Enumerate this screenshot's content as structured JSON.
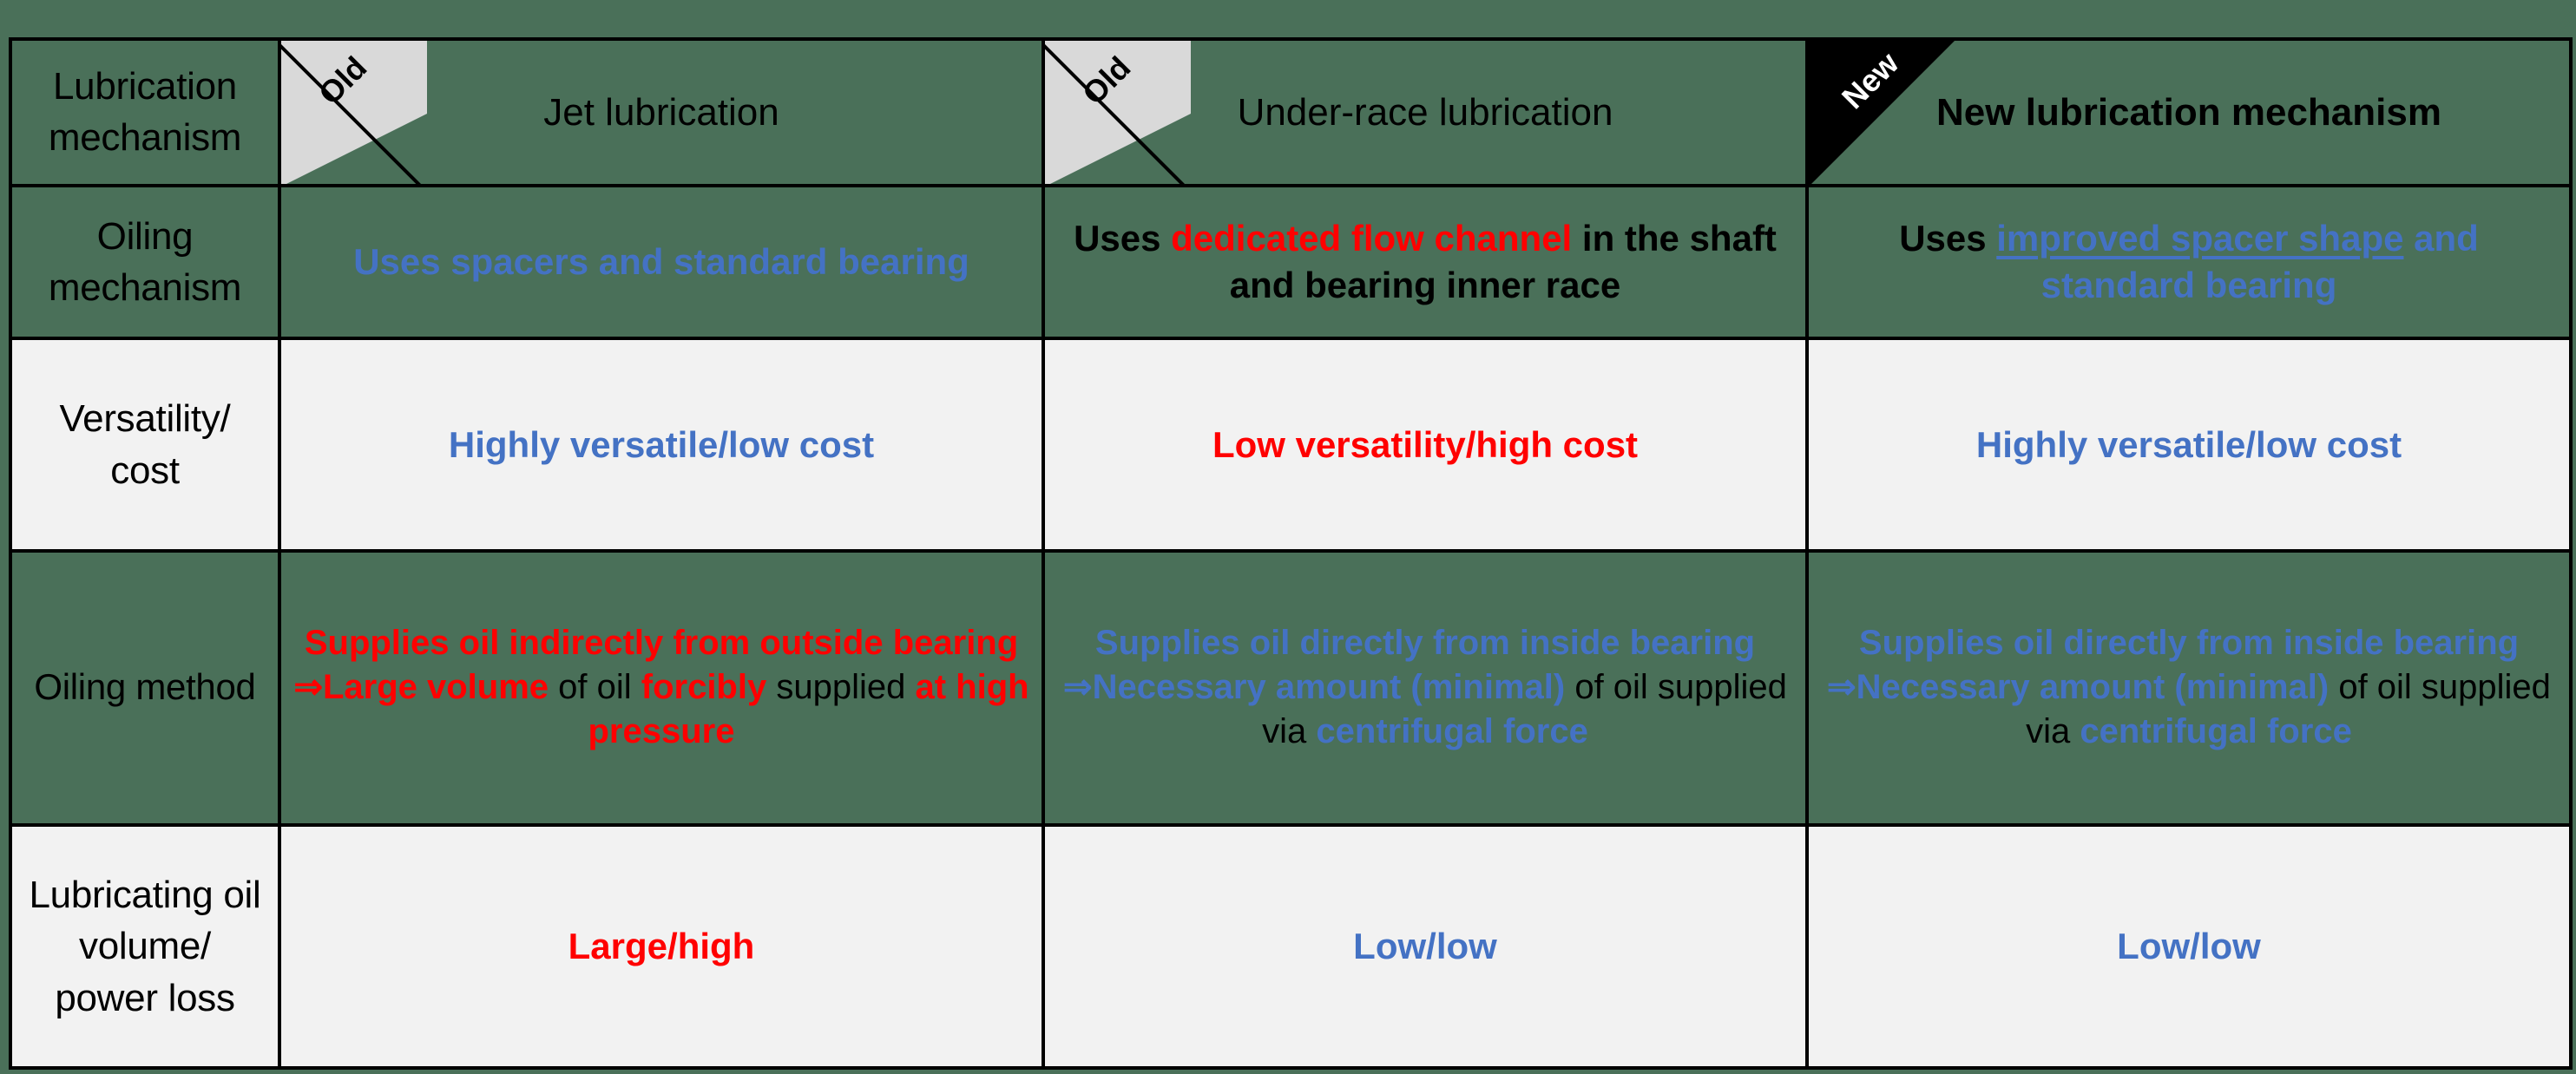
{
  "colors": {
    "page_background": "#4a7059",
    "blue": "#4472c4",
    "red": "#ff0000",
    "black": "#000000",
    "light_row": "#f2f2f2",
    "ribbon_old": "#d9d9d9",
    "ribbon_new": "#000000"
  },
  "ribbons": {
    "old": "Old",
    "new": "New"
  },
  "header": {
    "row_label": {
      "l1": "Lubrication",
      "l2": "mechanism"
    },
    "col1": "Jet lubrication",
    "col2": "Under-race lubrication",
    "col3": "New lubrication mechanism"
  },
  "rows": [
    {
      "id": "oiling-mechanism",
      "label": {
        "l1": "Oiling",
        "l2": "mechanism"
      },
      "background": "transparent",
      "col1": {
        "segments": [
          {
            "text": "Uses spacers and standard bearing",
            "color": "blue",
            "bold": true,
            "underline": false
          }
        ]
      },
      "col2": {
        "segments": [
          {
            "text": "Uses ",
            "color": "black",
            "bold": true,
            "underline": false
          },
          {
            "text": "dedicated flow channel",
            "color": "red",
            "bold": true,
            "underline": false
          },
          {
            "text": " in the shaft and bearing inner race",
            "color": "black",
            "bold": true,
            "underline": false
          }
        ]
      },
      "col3": {
        "segments": [
          {
            "text": "Uses ",
            "color": "black",
            "bold": true,
            "underline": false
          },
          {
            "text": "improved spacer shape",
            "color": "blue",
            "bold": true,
            "underline": true
          },
          {
            "text": " and standard bearing",
            "color": "blue",
            "bold": true,
            "underline": false
          }
        ]
      }
    },
    {
      "id": "versatility-cost",
      "label": {
        "l1": "Versatility/",
        "l2": "cost"
      },
      "background": "#f2f2f2",
      "col1": {
        "segments": [
          {
            "text": "Highly versatile/low cost",
            "color": "blue",
            "bold": true,
            "underline": false
          }
        ]
      },
      "col2": {
        "segments": [
          {
            "text": "Low versatility/high cost",
            "color": "red",
            "bold": true,
            "underline": false
          }
        ]
      },
      "col3": {
        "segments": [
          {
            "text": "Highly versatile/low cost",
            "color": "blue",
            "bold": true,
            "underline": false
          }
        ]
      }
    },
    {
      "id": "oiling-method",
      "label": {
        "l1": "Oiling method",
        "l2": ""
      },
      "background": "transparent",
      "col1": {
        "lines": [
          [
            {
              "text": "Supplies oil indirectly from outside bearing",
              "color": "red",
              "bold": true,
              "underline": false
            }
          ],
          [
            {
              "text": "⇒Large volume",
              "color": "red",
              "bold": true,
              "underline": false
            },
            {
              "text": " of oil ",
              "color": "black",
              "bold": false,
              "underline": false
            },
            {
              "text": "forcibly",
              "color": "red",
              "bold": true,
              "underline": false
            },
            {
              "text": " supplied ",
              "color": "black",
              "bold": false,
              "underline": false
            },
            {
              "text": "at high pressure",
              "color": "red",
              "bold": true,
              "underline": false
            }
          ]
        ]
      },
      "col2": {
        "lines": [
          [
            {
              "text": "Supplies oil directly from inside bearing",
              "color": "blue",
              "bold": true,
              "underline": false
            }
          ],
          [
            {
              "text": "⇒Necessary amount (minimal)",
              "color": "blue",
              "bold": true,
              "underline": false
            },
            {
              "text": " of oil supplied via ",
              "color": "black",
              "bold": false,
              "underline": false
            },
            {
              "text": "centrifugal force",
              "color": "blue",
              "bold": true,
              "underline": false
            }
          ]
        ]
      },
      "col3": {
        "lines": [
          [
            {
              "text": "Supplies oil directly from inside bearing",
              "color": "blue",
              "bold": true,
              "underline": false
            }
          ],
          [
            {
              "text": "⇒Necessary amount (minimal)",
              "color": "blue",
              "bold": true,
              "underline": false
            },
            {
              "text": " of oil supplied via ",
              "color": "black",
              "bold": false,
              "underline": false
            },
            {
              "text": "centrifugal force",
              "color": "blue",
              "bold": true,
              "underline": false
            }
          ]
        ]
      }
    },
    {
      "id": "lubricating-oil-volume-power-loss",
      "label": {
        "l1": "Lubricating oil",
        "l2": "volume/",
        "l3": "power loss"
      },
      "background": "#f2f2f2",
      "col1": {
        "segments": [
          {
            "text": "Large/high",
            "color": "red",
            "bold": true,
            "underline": false
          }
        ]
      },
      "col2": {
        "segments": [
          {
            "text": "Low/low",
            "color": "blue",
            "bold": true,
            "underline": false
          }
        ]
      },
      "col3": {
        "segments": [
          {
            "text": "Low/low",
            "color": "blue",
            "bold": true,
            "underline": false
          }
        ]
      }
    }
  ]
}
